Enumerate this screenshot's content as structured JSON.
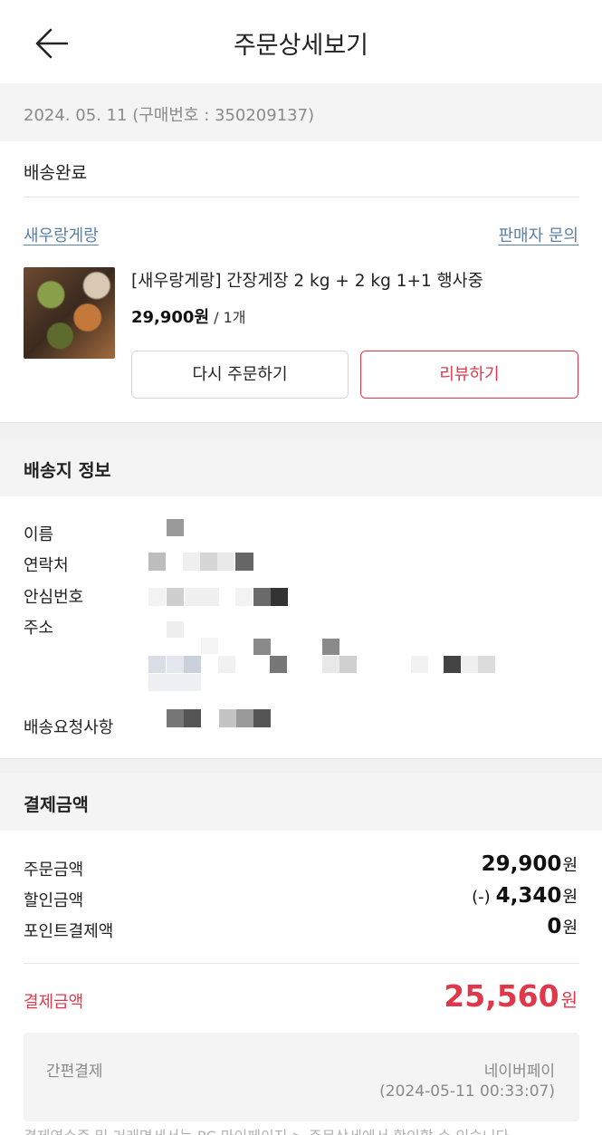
{
  "header": {
    "title": "주문상세보기",
    "back_icon": "arrow-left-icon"
  },
  "order": {
    "date_line": "2024. 05. 11 (구매번호 : 350209137)",
    "status": "배송완료"
  },
  "seller": {
    "name": "새우랑게랑",
    "inquiry_label": "판매자 문의"
  },
  "product": {
    "name": "[새우랑게랑] 간장게장 2 kg + 2 kg 1+1 행사중",
    "price": "29,900원",
    "qty": " / 1개",
    "reorder_label": "다시 주문하기",
    "review_label": "리뷰하기"
  },
  "shipping": {
    "title": "배송지 정보",
    "name_label": "이름",
    "phone_label": "연락처",
    "safe_number_label": "안심번호",
    "address_label": "주소",
    "request_label": "배송요청사항"
  },
  "payment": {
    "title": "결제금액",
    "order_amount_label": "주문금액",
    "order_amount_value": "29,900",
    "discount_label": "할인금액",
    "discount_sign": "(-)",
    "discount_value": "4,340",
    "points_label": "포인트결제액",
    "points_value": "0",
    "unit": "원",
    "total_label": "결제금액",
    "total_value": "25,560",
    "method_label": "간편결제",
    "method_name": "네이버페이",
    "method_time": "(2024-05-11 00:33:07)"
  },
  "footer": {
    "note": "결제영수증 및 거래명세서는 PC 마이페이지 > 주문상세에서 확인할 수 있습니다"
  },
  "colors": {
    "accent_red": "#e0384a",
    "link_blue": "#5b7fa8",
    "muted_gray": "#8a8a8a",
    "section_bg": "#f4f4f4"
  }
}
